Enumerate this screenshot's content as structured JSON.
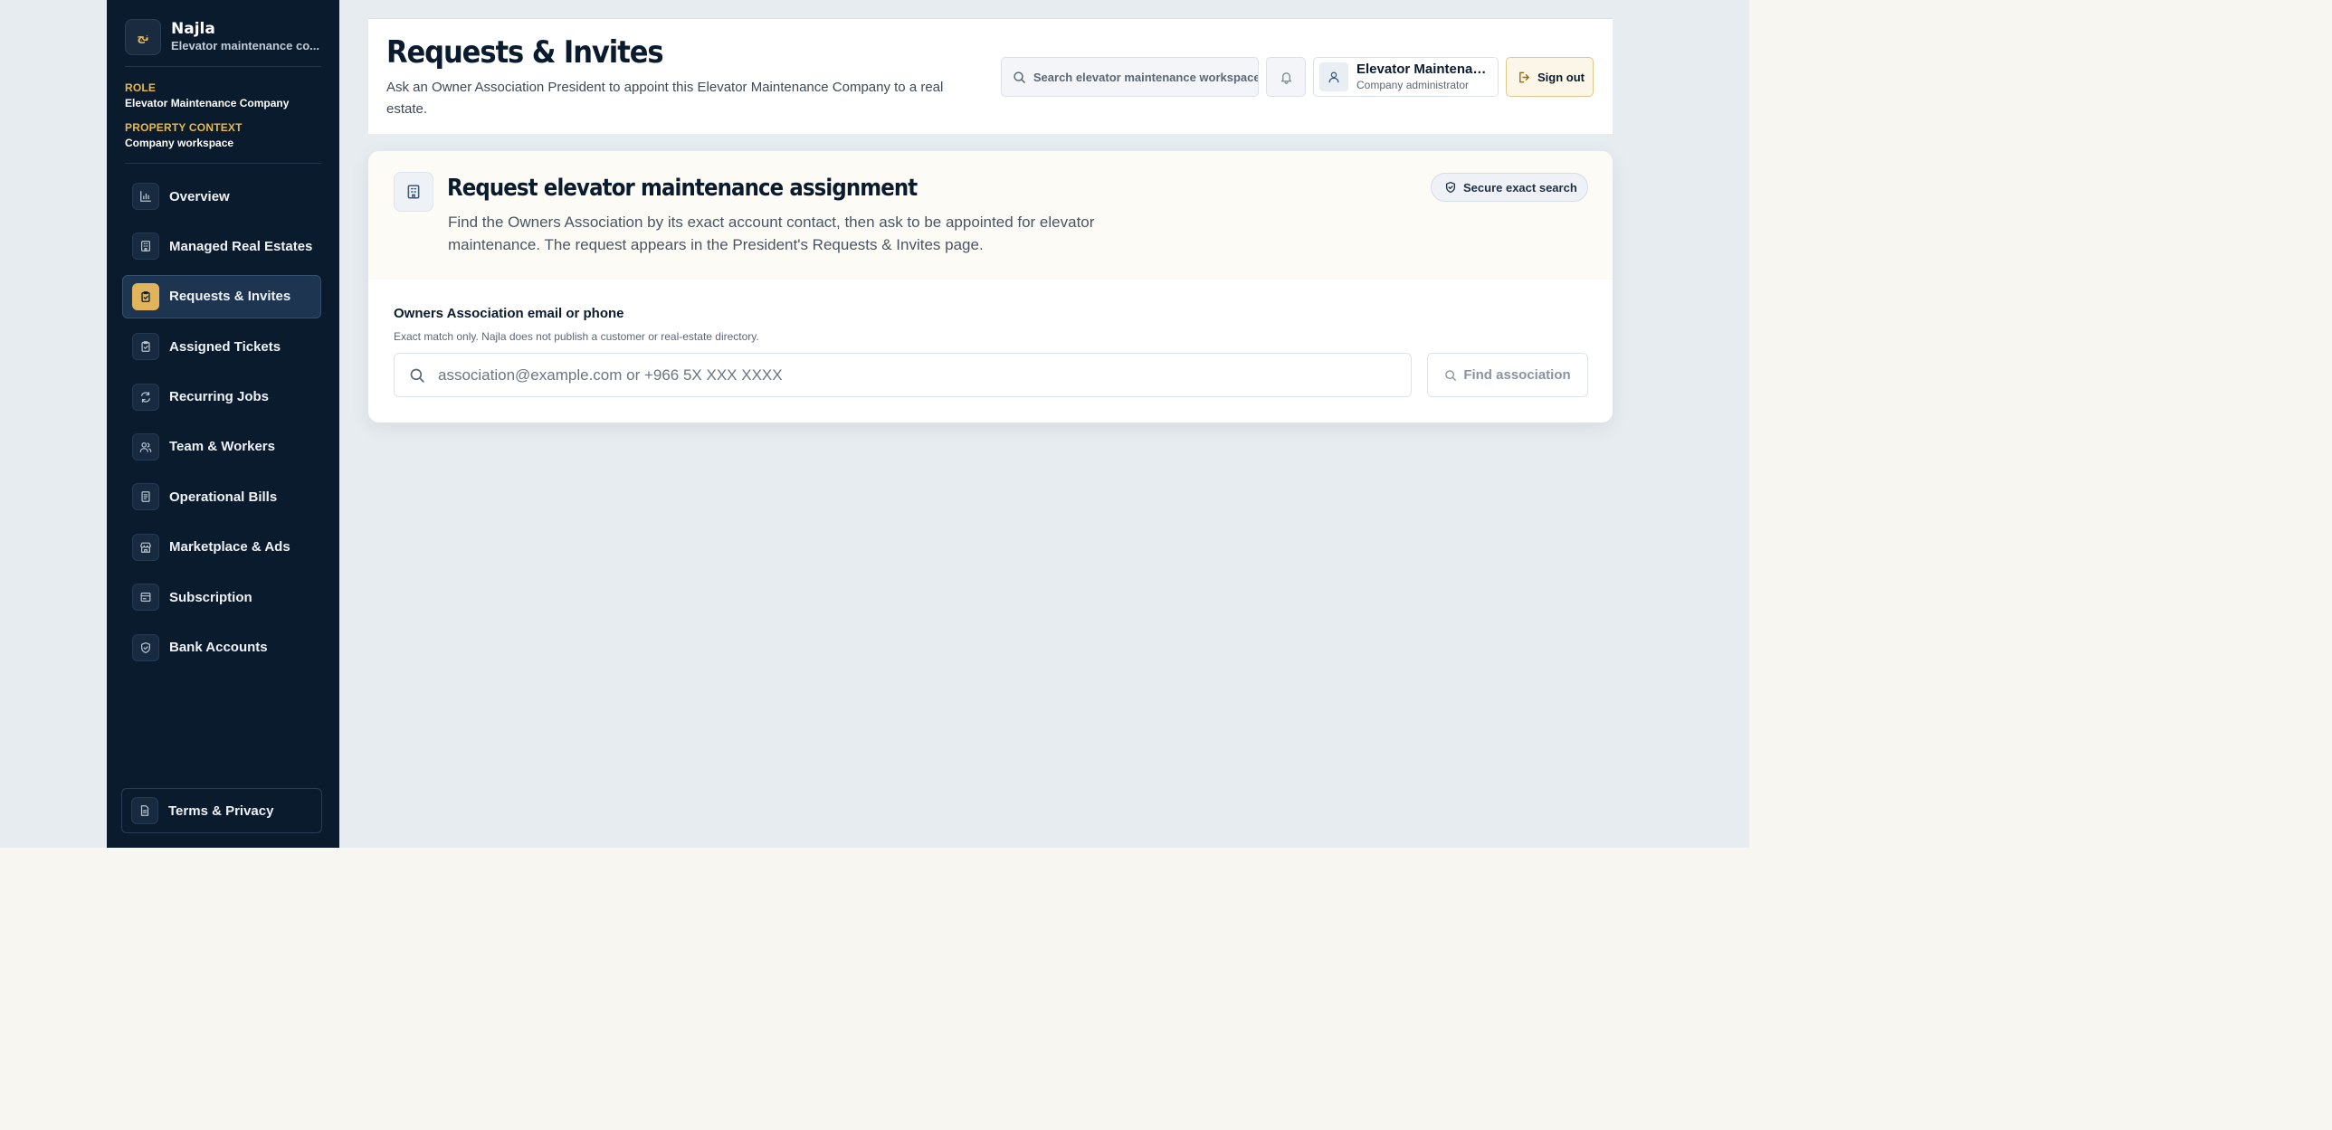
{
  "brand": {
    "name": "Najla",
    "subtitle": "Elevator maintenance co...",
    "logo_text": "نج"
  },
  "sidebar": {
    "role_label": "ROLE",
    "role_value": "Elevator Maintenance Company",
    "context_label": "PROPERTY CONTEXT",
    "context_value": "Company workspace",
    "items": [
      {
        "label": "Overview",
        "icon": "bar-chart-icon"
      },
      {
        "label": "Managed Real Estates",
        "icon": "building-icon"
      },
      {
        "label": "Requests & Invites",
        "icon": "clipboard-check-icon",
        "active": true
      },
      {
        "label": "Assigned Tickets",
        "icon": "clipboard-icon"
      },
      {
        "label": "Recurring Jobs",
        "icon": "refresh-icon"
      },
      {
        "label": "Team & Workers",
        "icon": "users-icon"
      },
      {
        "label": "Operational Bills",
        "icon": "receipt-icon"
      },
      {
        "label": "Marketplace & Ads",
        "icon": "store-icon"
      },
      {
        "label": "Subscription",
        "icon": "card-icon"
      },
      {
        "label": "Bank Accounts",
        "icon": "shield-icon"
      }
    ],
    "footer_label": "Terms & Privacy"
  },
  "header": {
    "title": "Requests & Invites",
    "subtitle": "Ask an Owner Association President to appoint this Elevator Maintenance Company to a real estate.",
    "search_placeholder": "Search elevator maintenance workspace",
    "user_name": "Elevator Maintenance Company",
    "user_role": "Company administrator",
    "signout_label": "Sign out"
  },
  "card": {
    "title": "Request elevator maintenance assignment",
    "description": "Find the Owners Association by its exact account contact, then ask to be appointed for elevator maintenance. The request appears in the President's Requests & Invites page.",
    "badge": "Secure exact search",
    "field_label": "Owners Association email or phone",
    "field_hint": "Exact match only. Najla does not publish a customer or real-estate directory.",
    "input_placeholder": "association@example.com or +966 5X XXX XXXX",
    "input_value": "",
    "button_label": "Find association"
  },
  "colors": {
    "sidebar_bg": "#0b1b2e",
    "accent": "#e0b45a",
    "page_bg": "#e7ecf0"
  }
}
